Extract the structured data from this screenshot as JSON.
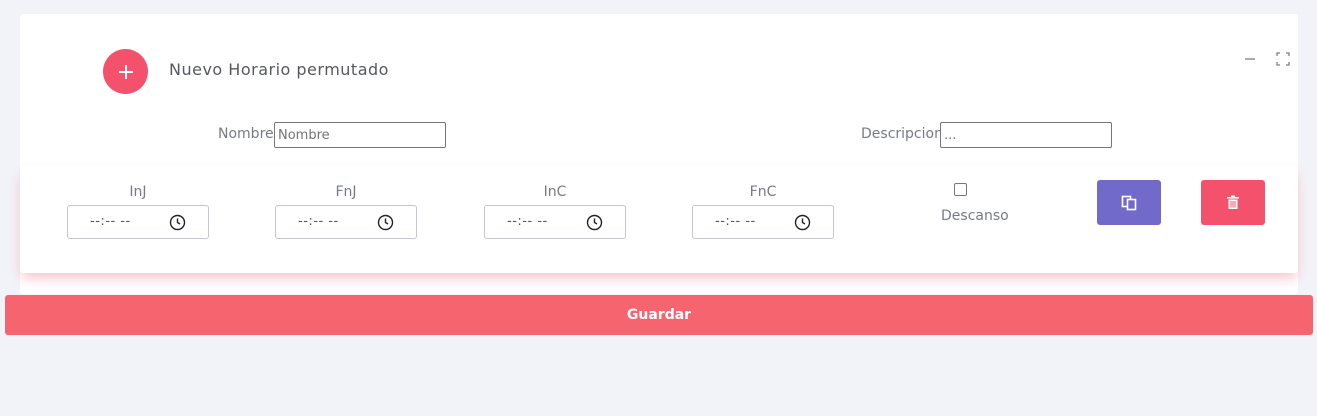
{
  "header": {
    "title": "Nuevo Horario permutado",
    "icon": "plus-icon",
    "accent_color": "#f4516c"
  },
  "tools": {
    "minimize_icon": "minus-icon",
    "fullscreen_icon": "expand-icon"
  },
  "form": {
    "nombre_label": "Nombre",
    "nombre_placeholder": "Nombre",
    "descripcion_label": "Descripcion",
    "descripcion_placeholder": "..."
  },
  "schedule_row": {
    "fields": [
      {
        "label": "InJ",
        "value": "--:-- --"
      },
      {
        "label": "FnJ",
        "value": "--:-- --"
      },
      {
        "label": "InC",
        "value": "--:-- --"
      },
      {
        "label": "FnC",
        "value": "--:-- --"
      }
    ],
    "descanso_label": "Descanso",
    "descanso_checked": false,
    "copy_icon": "copy-icon",
    "delete_icon": "trash-icon",
    "copy_color": "#716aca",
    "delete_color": "#f4516c"
  },
  "save_button": {
    "label": "Guardar",
    "color": "#f66470"
  }
}
